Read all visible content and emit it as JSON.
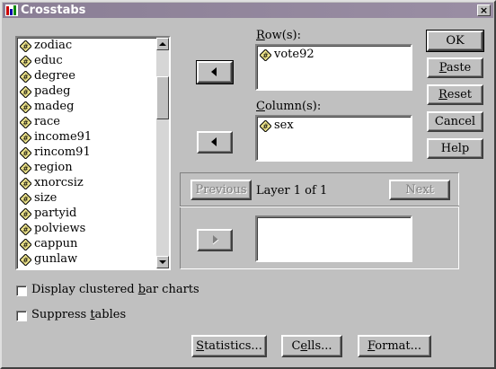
{
  "window": {
    "title": "Crosstabs",
    "close_glyph": "×"
  },
  "variables": [
    "zodiac",
    "educ",
    "degree",
    "padeg",
    "madeg",
    "race",
    "income91",
    "rincom91",
    "region",
    "xnorcsiz",
    "size",
    "partyid",
    "polviews",
    "cappun",
    "gunlaw"
  ],
  "rows": {
    "label": "Row(s):",
    "items": [
      "vote92"
    ]
  },
  "columns": {
    "label": "Column(s):",
    "items": [
      "sex"
    ]
  },
  "layer": {
    "text": "Layer 1 of 1",
    "previous": "Previous",
    "next": "Next"
  },
  "buttons": {
    "ok": "OK",
    "paste": "Paste",
    "reset": "Reset",
    "cancel": "Cancel",
    "help": "Help"
  },
  "options": {
    "clustered": {
      "label": "Display clustered bar charts",
      "checked": false
    },
    "suppress": {
      "label": "Suppress tables",
      "checked": false
    }
  },
  "bottom": {
    "statistics": "Statistics...",
    "cells": "Cells...",
    "format": "Format..."
  }
}
